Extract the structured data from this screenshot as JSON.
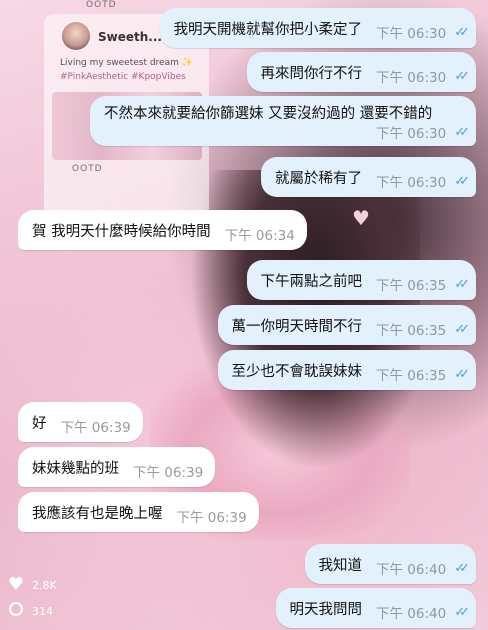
{
  "background_post": {
    "ootd_label": "OOTD",
    "username": "Sweeth...",
    "bio": "Living my sweetest dream ✨",
    "tags": "#PinkAesthetic #KpopVibes"
  },
  "stats": {
    "likes": "2.8K",
    "comments": "314"
  },
  "messages": [
    {
      "dir": "out",
      "text": "我明天開機就幫你把小柔定了",
      "time": "下午 06:30",
      "read": "✓✓"
    },
    {
      "dir": "out",
      "text": "再來問你行不行",
      "time": "下午 06:30",
      "read": "✓✓"
    },
    {
      "dir": "out",
      "text": "不然本來就要給你篩選妹 又要沒約過的  還要不錯的",
      "time": "下午 06:30",
      "read": "✓✓"
    },
    {
      "dir": "out",
      "text": "就屬於稀有了",
      "time": "下午 06:30",
      "read": "✓✓"
    },
    {
      "dir": "in",
      "text": "賀 我明天什麼時候給你時間",
      "time": "下午 06:34"
    },
    {
      "dir": "out",
      "text": "下午兩點之前吧",
      "time": "下午 06:35",
      "read": "✓✓"
    },
    {
      "dir": "out",
      "text": "萬一你明天時間不行",
      "time": "下午 06:35",
      "read": "✓✓"
    },
    {
      "dir": "out",
      "text": "至少也不會耽誤妹妹",
      "time": "下午 06:35",
      "read": "✓✓"
    },
    {
      "dir": "in",
      "text": "好",
      "time": "下午 06:39"
    },
    {
      "dir": "in",
      "text": "妹妹幾點的班",
      "time": "下午 06:39"
    },
    {
      "dir": "in",
      "text": "我應該有也是晚上喔",
      "time": "下午 06:39"
    },
    {
      "dir": "out",
      "text": "我知道",
      "time": "下午 06:40",
      "read": "✓✓"
    },
    {
      "dir": "out",
      "text": "明天我問問",
      "time": "下午 06:40",
      "read": "✓✓"
    }
  ]
}
